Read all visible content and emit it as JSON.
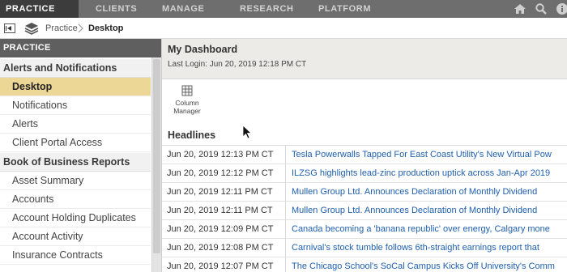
{
  "nav": {
    "items": [
      {
        "label": "PRACTICE",
        "active": true
      },
      {
        "label": "CLIENTS"
      },
      {
        "label": "MANAGE"
      },
      {
        "label": "RESEARCH"
      },
      {
        "label": "PLATFORM"
      }
    ],
    "icons": [
      "home-icon",
      "search-icon",
      "info-icon"
    ]
  },
  "breadcrumb": {
    "parent": "Practice",
    "current": "Desktop"
  },
  "sidebar": {
    "header": "PRACTICE",
    "sections": [
      {
        "title": "Alerts and Notifications",
        "items": [
          "Desktop",
          "Notifications",
          "Alerts",
          "Client Portal Access"
        ]
      },
      {
        "title": "Book of Business Reports",
        "items": [
          "Asset Summary",
          "Accounts",
          "Account Holding Duplicates",
          "Account Activity",
          "Insurance Contracts"
        ]
      }
    ],
    "active_item": "Desktop"
  },
  "dashboard": {
    "title": "My Dashboard",
    "last_login": "Last Login: Jun 20, 2019 12:18 PM CT",
    "column_manager_label": "Column Manager",
    "headlines_title": "Headlines"
  },
  "headlines": [
    {
      "time": "Jun 20, 2019 12:13 PM CT",
      "title": "Tesla Powerwalls Tapped For East Coast Utility's New Virtual Pow"
    },
    {
      "time": "Jun 20, 2019 12:12 PM CT",
      "title": "ILZSG highlights lead-zinc production uptick across Jan-Apr 2019"
    },
    {
      "time": "Jun 20, 2019 12:11 PM CT",
      "title": "Mullen Group Ltd. Announces Declaration of Monthly Dividend"
    },
    {
      "time": "Jun 20, 2019 12:11 PM CT",
      "title": "Mullen Group Ltd. Announces Declaration of Monthly Dividend"
    },
    {
      "time": "Jun 20, 2019 12:09 PM CT",
      "title": "Canada becoming a 'banana republic' over energy, Calgary mone"
    },
    {
      "time": "Jun 20, 2019 12:08 PM CT",
      "title": "Carnival's stock tumble follows 6th-straight earnings report that"
    },
    {
      "time": "Jun 20, 2019 12:07 PM CT",
      "title": "The Chicago School's SoCal Campus Kicks Off University's Comm"
    }
  ],
  "colors": {
    "nav_bg": "#6e6e6e",
    "nav_active_bg": "#3c3c3c",
    "sidebar_active_bg": "#edd797",
    "link": "#1f5fae"
  }
}
